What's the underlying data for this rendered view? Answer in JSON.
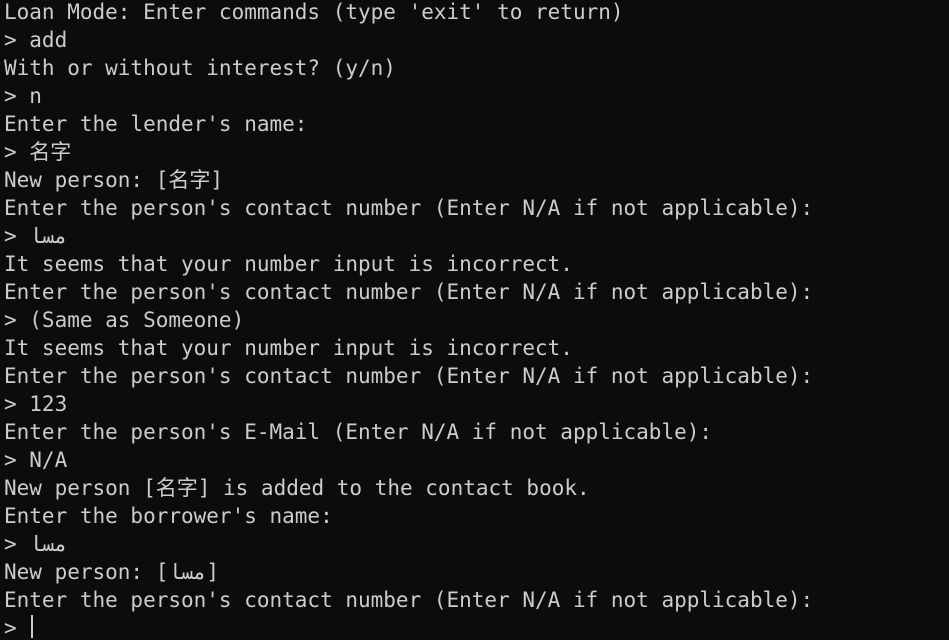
{
  "terminal": {
    "background": "#0c0c0c",
    "foreground": "#cccccc",
    "lines": [
      "Loan Mode: Enter commands (type 'exit' to return)",
      "> add",
      "With or without interest? (y/n)",
      "> n",
      "Enter the lender's name:",
      "> 名字",
      "New person: [名字]",
      "Enter the person's contact number (Enter N/A if not applicable):",
      "> مسا",
      "It seems that your number input is incorrect.",
      "Enter the person's contact number (Enter N/A if not applicable):",
      "> (Same as Someone)",
      "It seems that your number input is incorrect.",
      "Enter the person's contact number (Enter N/A if not applicable):",
      "> 123",
      "Enter the person's E-Mail (Enter N/A if not applicable):",
      "> N/A",
      "New person [名字] is added to the contact book.",
      "Enter the borrower's name:",
      "> مسا",
      "New person: [مسا]",
      "Enter the person's contact number (Enter N/A if not applicable):"
    ],
    "prompt": "> "
  }
}
